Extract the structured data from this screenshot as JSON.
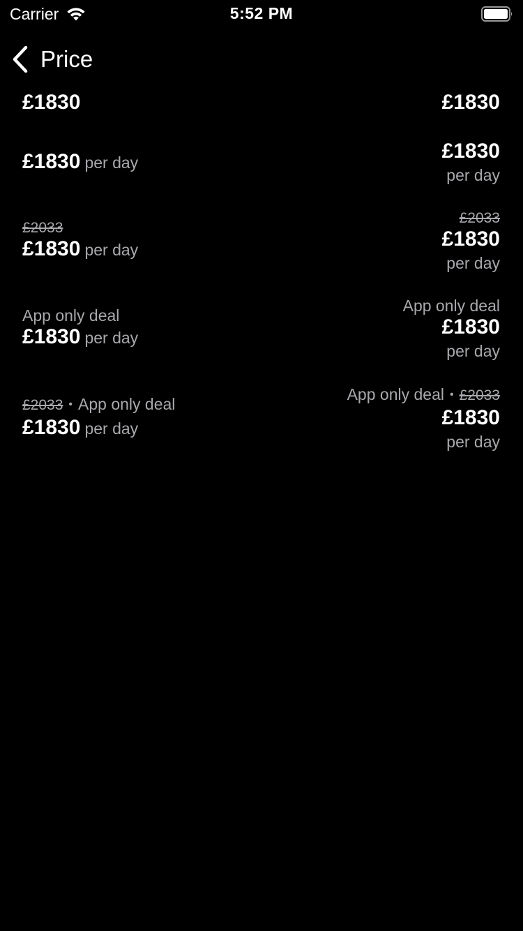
{
  "status_bar": {
    "carrier": "Carrier",
    "time": "5:52 PM",
    "icons": [
      "wifi-icon",
      "battery-icon"
    ]
  },
  "nav": {
    "back_label": "Price",
    "back_icon": "chevron-left-icon"
  },
  "rows": [
    {
      "left": {
        "price": "£1830"
      },
      "right": {
        "price": "£1830"
      }
    },
    {
      "left": {
        "price": "£1830",
        "unit": "per day"
      },
      "right": {
        "price": "£1830",
        "unit": "per day"
      }
    },
    {
      "left": {
        "old_price": "£2033",
        "price": "£1830",
        "unit": "per day"
      },
      "right": {
        "old_price": "£2033",
        "price": "£1830",
        "unit": "per day"
      }
    },
    {
      "left": {
        "deal": "App only deal",
        "price": "£1830",
        "unit": "per day"
      },
      "right": {
        "deal": "App only deal",
        "price": "£1830",
        "unit": "per day"
      }
    },
    {
      "left": {
        "old_price": "£2033",
        "separator": "•",
        "deal": "App only deal",
        "price": "£1830",
        "unit": "per day"
      },
      "right": {
        "deal": "App only deal",
        "separator": "•",
        "old_price": "£2033",
        "price": "£1830",
        "unit": "per day"
      }
    }
  ],
  "colors": {
    "background": "#000000",
    "primary_text": "#ffffff",
    "secondary_text": "#a8a8ad"
  }
}
